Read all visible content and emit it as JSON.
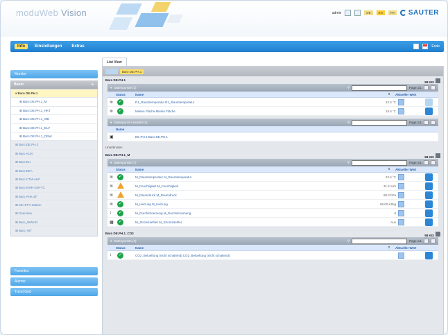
{
  "header": {
    "logo_main": "moduWeb",
    "logo_sub": "Vision",
    "user": "admin",
    "languages": [
      "DE",
      "EN",
      "FR"
    ],
    "active_language": "EN",
    "brand": "SAUTER"
  },
  "navbar": {
    "items": [
      "Info",
      "Einstellungen",
      "Extras"
    ],
    "active": "Info",
    "right_label": "Ende"
  },
  "sidebar": {
    "top_button": "Monitor",
    "tree_title": "Baum",
    "nodes": [
      {
        "label": "Baro DE.PH.1",
        "type": "sel"
      },
      {
        "label": "Baro DE.PH.1_M",
        "type": "child"
      },
      {
        "label": "Baro DE.PH.1_HKT",
        "type": "child"
      },
      {
        "label": "Baro DE.PH.1_WD",
        "type": "child"
      },
      {
        "label": "Baro DE.PH.1_ELV",
        "type": "child"
      },
      {
        "label": "Baro DE.PH.1_Other",
        "type": "child"
      },
      {
        "label": "Baro DE.PH.2",
        "type": "grey"
      },
      {
        "label": "Baro ALM",
        "type": "grey"
      },
      {
        "label": "Baro EU",
        "type": "grey"
      },
      {
        "label": "Baro EEA",
        "type": "grey"
      },
      {
        "label": "Baro CTM-AHF",
        "type": "grey"
      },
      {
        "label": "Baro KWK-GW-TC",
        "type": "grey"
      },
      {
        "label": "Baro AHK-ZF",
        "type": "grey"
      },
      {
        "label": "MC-ETX Station",
        "type": "grey"
      },
      {
        "label": "Overview",
        "type": "grey"
      },
      {
        "label": "Baro_WWHG",
        "type": "grey"
      },
      {
        "label": "Baro_WT",
        "type": "grey"
      }
    ],
    "bottom_buttons": [
      "Favorites",
      "Alarme",
      "Trend Grid"
    ]
  },
  "main": {
    "tab": "List View",
    "breadcrumb": "Baro DE.PH.1",
    "sections": [
      {
        "title": "Baro DE.PH.1",
        "count": "58 KIX",
        "groups": [
          {
            "title": "Datenpunkte (2)",
            "page": "Page 1/1",
            "columns": [
              "Status",
              "Name",
              "Aktueller Wert"
            ],
            "rows": [
              {
                "ic": "≋",
                "status": "ok",
                "name": "R1_Raumtemperatur R1_Raumtemperatur",
                "value": "22.5 °C",
                "edit": false
              },
              {
                "ic": "≋",
                "status": "ok",
                "name": "Mieten Fläche Mieten Fläche",
                "value": "15.6 °C",
                "edit": true
              }
            ]
          },
          {
            "title": "Datenpunkt-Auswahl (1)",
            "page": "Page 1/1",
            "columns": [
              "Name"
            ],
            "rows": [
              {
                "ic": "▣",
                "status": "",
                "name": "DE.PH.1 Baro DE.PH.1",
                "value": "",
                "edit": null
              }
            ]
          }
        ]
      },
      {
        "subtitle": "Unterknoten",
        "title": "Baro DE.PH.1_M",
        "count": "58 KIX",
        "groups": [
          {
            "title": "Datenpunkte (7)",
            "page": "Page 1/1",
            "columns": [
              "Status",
              "Name",
              "Aktueller Wert"
            ],
            "rows": [
              {
                "ic": "≋",
                "status": "ok",
                "name": "M_Raumtemperatur M_Raumtemperatur",
                "value": "22.5 °C",
                "edit": true
              },
              {
                "ic": "≋",
                "status": "warn",
                "name": "M_Feuchtigkeit M_Feuchtigkeit",
                "value": "31.5 %rh",
                "edit": true
              },
              {
                "ic": "≋",
                "status": "warn",
                "name": "M_Raumdruck M_Raumdruck",
                "value": "98.3 hPa",
                "edit": true
              },
              {
                "ic": "≋",
                "status": "ok",
                "name": "M_Heizung M_Heizung",
                "value": "98.00 kJ/kg",
                "edit": true
              },
              {
                "ic": "↕",
                "status": "ok",
                "name": "M_Durchstroemung M_Durchstroemung",
                "value": "0",
                "edit": true
              },
              {
                "ic": "▦",
                "status": "ok",
                "name": "M_Stromzaehler M_Stromzaehler",
                "value": "Aus",
                "edit": true
              }
            ]
          }
        ]
      },
      {
        "title": "Baro DE.PH.1_CO2",
        "count": "58 KIX",
        "groups": [
          {
            "title": "Datenpunkte (2)",
            "page": "Page 1/1",
            "columns": [
              "Status",
              "Name",
              "Aktueller Wert"
            ],
            "rows": [
              {
                "ic": "↕",
                "status": "ok",
                "name": "CO2_Belueftung (nicht schaltend) CO2_Belueftung (nicht schaltend)",
                "value": "",
                "edit": true
              }
            ]
          }
        ]
      }
    ]
  },
  "colors": {
    "nav_blue": "#1f7fcf",
    "highlight_yellow": "#ffe066",
    "ok_green": "#1da34a",
    "warn_orange": "#f0a22d",
    "brand_blue": "#1d6fb8"
  }
}
